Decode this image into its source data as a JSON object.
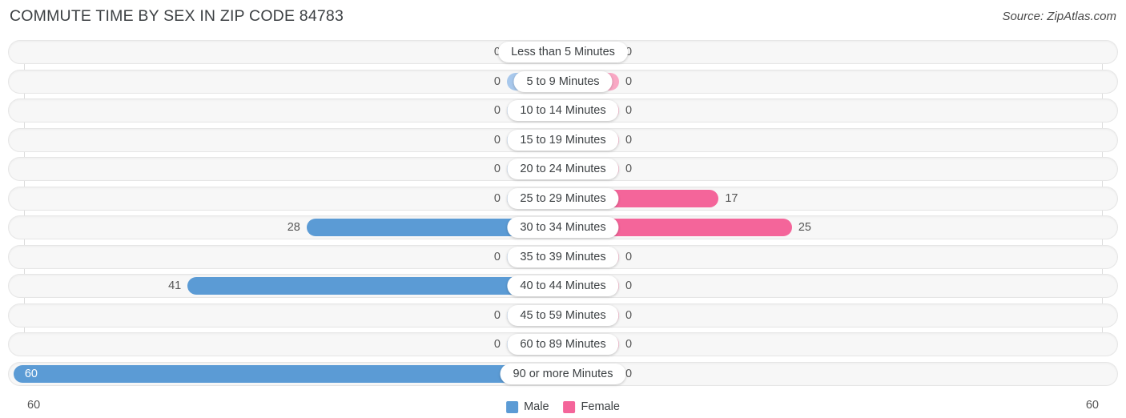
{
  "header": {
    "title": "COMMUTE TIME BY SEX IN ZIP CODE 84783",
    "source": "Source: ZipAtlas.com"
  },
  "legend": {
    "male_label": "Male",
    "female_label": "Female",
    "male_color": "#5b9bd5",
    "female_color": "#f4659a",
    "male_zero_color": "#a8c8ec",
    "female_zero_color": "#f9a8c4"
  },
  "axis": {
    "left_label": "60",
    "right_label": "60",
    "max": 60
  },
  "chart_data": {
    "type": "bar",
    "title": "COMMUTE TIME BY SEX IN ZIP CODE 84783",
    "subtitle": "Source: ZipAtlas.com",
    "orientation": "horizontal-diverging",
    "xlabel": "",
    "ylabel": "",
    "xlim": [
      60,
      60
    ],
    "grid": true,
    "legend_position": "bottom-center",
    "categories": [
      "Less than 5 Minutes",
      "5 to 9 Minutes",
      "10 to 14 Minutes",
      "15 to 19 Minutes",
      "20 to 24 Minutes",
      "25 to 29 Minutes",
      "30 to 34 Minutes",
      "35 to 39 Minutes",
      "40 to 44 Minutes",
      "45 to 59 Minutes",
      "60 to 89 Minutes",
      "90 or more Minutes"
    ],
    "series": [
      {
        "name": "Male",
        "values": [
          0,
          0,
          0,
          0,
          0,
          0,
          28,
          0,
          41,
          0,
          0,
          60
        ]
      },
      {
        "name": "Female",
        "values": [
          0,
          0,
          0,
          0,
          0,
          17,
          25,
          0,
          0,
          0,
          0,
          0
        ]
      }
    ]
  },
  "rows": [
    {
      "label": "Less than 5 Minutes",
      "male": "0",
      "female": "0"
    },
    {
      "label": "5 to 9 Minutes",
      "male": "0",
      "female": "0"
    },
    {
      "label": "10 to 14 Minutes",
      "male": "0",
      "female": "0"
    },
    {
      "label": "15 to 19 Minutes",
      "male": "0",
      "female": "0"
    },
    {
      "label": "20 to 24 Minutes",
      "male": "0",
      "female": "0"
    },
    {
      "label": "25 to 29 Minutes",
      "male": "0",
      "female": "17"
    },
    {
      "label": "30 to 34 Minutes",
      "male": "28",
      "female": "25"
    },
    {
      "label": "35 to 39 Minutes",
      "male": "0",
      "female": "0"
    },
    {
      "label": "40 to 44 Minutes",
      "male": "41",
      "female": "0"
    },
    {
      "label": "45 to 59 Minutes",
      "male": "0",
      "female": "0"
    },
    {
      "label": "60 to 89 Minutes",
      "male": "0",
      "female": "0"
    },
    {
      "label": "90 or more Minutes",
      "male": "60",
      "female": "0"
    }
  ]
}
